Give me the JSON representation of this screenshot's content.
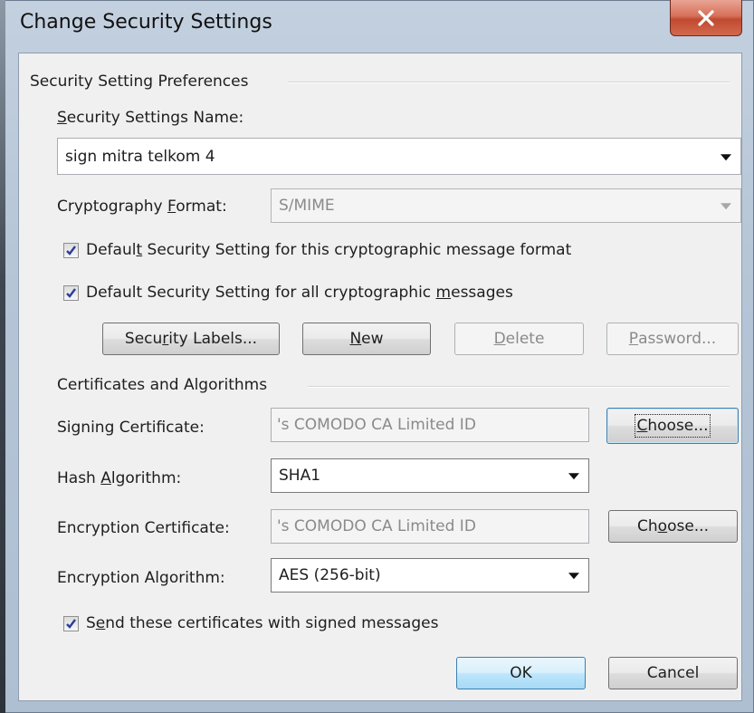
{
  "window": {
    "title": "Change Security Settings"
  },
  "prefs": {
    "group_label": "Security Setting Preferences",
    "name_label_pre": "",
    "name_label_u": "S",
    "name_label_post": "ecurity Settings Name:",
    "name_value": "sign mitra telkom 4",
    "format_label_pre": "Cryptography ",
    "format_label_u": "F",
    "format_label_post": "ormat:",
    "format_value": "S/MIME",
    "cb_default_format": {
      "checked": true,
      "pre": "Defaul",
      "u": "t",
      "post": " Security Setting for this cryptographic message format"
    },
    "cb_default_all": {
      "checked": true,
      "pre": "Default Security Setting for all cryptographic ",
      "u": "m",
      "post": "essages"
    },
    "btn_labels": {
      "pre": "Secu",
      "u": "r",
      "post": "ity Labels..."
    },
    "btn_new": {
      "pre": "",
      "u": "N",
      "post": "ew"
    },
    "btn_delete": {
      "pre": "",
      "u": "D",
      "post": "elete"
    },
    "btn_password": {
      "pre": "",
      "u": "P",
      "post": "assword..."
    }
  },
  "certs": {
    "group_label": "Certificates and Algorithms",
    "signing_label": "Signing Certificate:",
    "signing_value": "'s COMODO CA Limited ID",
    "choose1": {
      "pre": "",
      "u": "C",
      "post": "hoose..."
    },
    "hash_label_pre": "Hash ",
    "hash_label_u": "A",
    "hash_label_post": "lgorithm:",
    "hash_value": "SHA1",
    "encryption_label": "Encryption Certificate:",
    "encryption_value": "'s COMODO CA Limited ID",
    "choose2": {
      "pre": "Ch",
      "u": "o",
      "post": "ose..."
    },
    "enc_alg_label": "Encryption Algorithm:",
    "enc_alg_value": "AES (256-bit)",
    "cb_send": {
      "checked": true,
      "pre": "S",
      "u": "e",
      "post": "nd these certificates with signed messages"
    }
  },
  "footer": {
    "ok": "OK",
    "cancel": "Cancel"
  },
  "colors": {
    "checkmark": "#2a3e9c",
    "default_button_border": "#3c7fb1",
    "close_button": "#c9553b"
  },
  "icons": {
    "close": "close-icon",
    "dropdown": "chevron-down-icon",
    "check": "checkmark-icon"
  }
}
